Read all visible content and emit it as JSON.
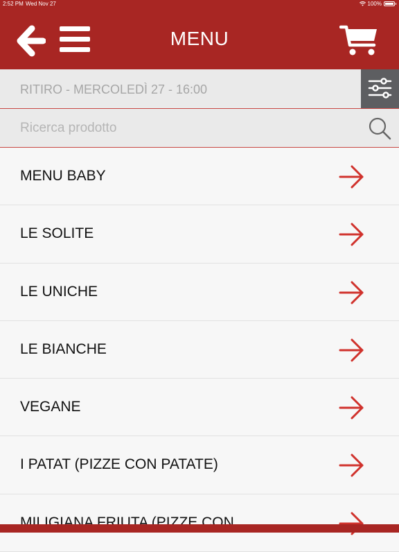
{
  "status_bar": {
    "time": "2:52 PM",
    "date": "Wed Nov 27",
    "battery": "100%"
  },
  "header": {
    "title": "MENU",
    "back_icon": "arrow-left-icon",
    "menu_icon": "hamburger-icon",
    "cart_icon": "shopping-cart-icon",
    "background_color": "#a82623"
  },
  "pickup": {
    "label": "RITIRO - MERCOLEDÌ 27 - 16:00",
    "filter_icon": "sliders-icon"
  },
  "search": {
    "placeholder": "Ricerca prodotto",
    "value": "",
    "icon": "search-icon"
  },
  "categories": [
    {
      "label": "MENU BABY"
    },
    {
      "label": "LE SOLITE"
    },
    {
      "label": "LE UNICHE"
    },
    {
      "label": "LE BIANCHE"
    },
    {
      "label": "VEGANE"
    },
    {
      "label": "I PATAT (PIZZE CON PATATE)"
    },
    {
      "label": "MILIGIANA FRIUTA (PIZZE CON"
    }
  ],
  "colors": {
    "accent": "#a82623",
    "arrow": "#d0322c",
    "filter_button": "#5d5e61"
  }
}
